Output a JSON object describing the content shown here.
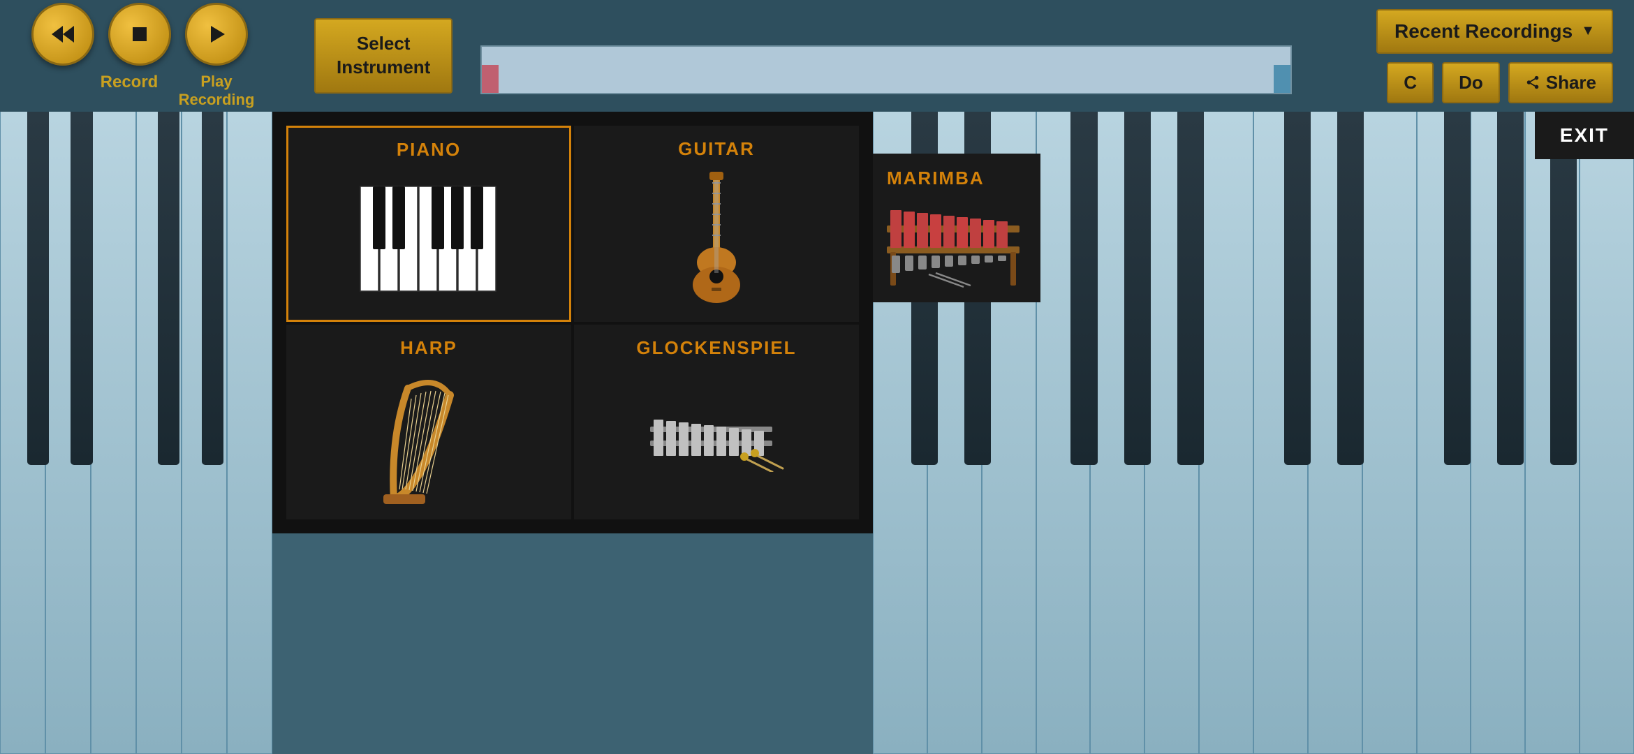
{
  "topbar": {
    "record_label": "Record",
    "play_label": "Play Recording",
    "select_instrument_label": "Select\nInstrument",
    "recent_recordings_label": "Recent Recordings",
    "note_c_label": "C",
    "note_do_label": "Do",
    "share_label": "Share",
    "exit_label": "EXIT"
  },
  "instruments": [
    {
      "id": "piano",
      "name": "PIANO",
      "selected": true
    },
    {
      "id": "guitar",
      "name": "GUITAR",
      "selected": false
    },
    {
      "id": "harp",
      "name": "HARP",
      "selected": false
    },
    {
      "id": "glockenspiel",
      "name": "GLOCKENSPIEL",
      "selected": false
    }
  ],
  "marimba": {
    "name": "MARIMBA"
  },
  "colors": {
    "gold": "#d4a820",
    "dark_gold": "#a07810",
    "instrument_text": "#d4820a",
    "bg": "#111111",
    "piano_bg": "#b8d4e0"
  }
}
